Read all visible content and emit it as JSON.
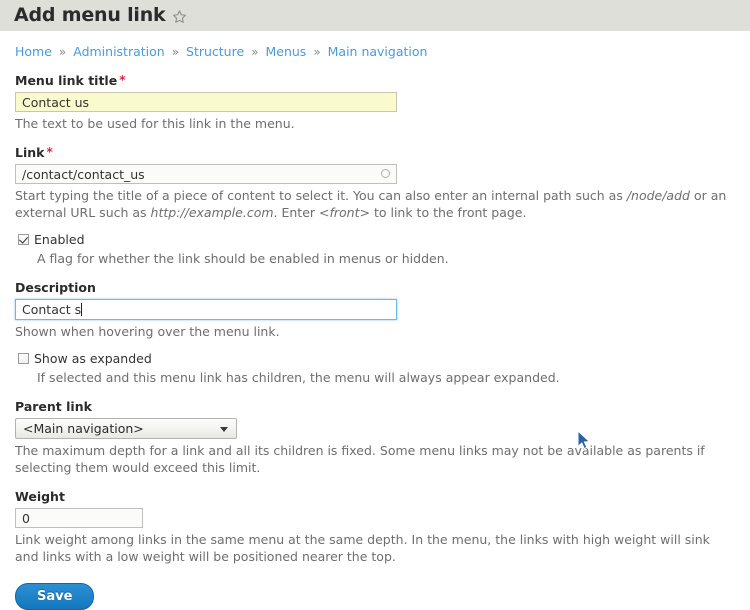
{
  "header": {
    "title": "Add menu link",
    "star_icon": "star-outline-icon"
  },
  "breadcrumb": {
    "separator": "»",
    "items": [
      {
        "label": "Home"
      },
      {
        "label": "Administration"
      },
      {
        "label": "Structure"
      },
      {
        "label": "Menus"
      },
      {
        "label": "Main navigation"
      }
    ]
  },
  "form": {
    "menu_link_title": {
      "label": "Menu link title",
      "required_mark": "*",
      "value": "Contact us",
      "description": "The text to be used for this link in the menu."
    },
    "link": {
      "label": "Link",
      "required_mark": "*",
      "value": "/contact/contact_us",
      "throbber_icon": "autocomplete-throbber-icon",
      "description_part1": "Start typing the title of a piece of content to select it. You can also enter an internal path such as ",
      "description_em1": "/node/add",
      "description_part2": " or an external URL such as ",
      "description_em2": "http://example.com",
      "description_part3": ". Enter <",
      "description_em3": "front",
      "description_part4": "> to link to the front page."
    },
    "enabled": {
      "label": "Enabled",
      "checked": true,
      "description": "A flag for whether the link should be enabled in menus or hidden."
    },
    "description_field": {
      "label": "Description",
      "value": "Contact s",
      "focused": true,
      "description": "Shown when hovering over the menu link."
    },
    "show_as_expanded": {
      "label": "Show as expanded",
      "checked": false,
      "description": "If selected and this menu link has children, the menu will always appear expanded."
    },
    "parent_link": {
      "label": "Parent link",
      "selected": "<Main navigation>",
      "chevron_icon": "chevron-down-icon",
      "description": "The maximum depth for a link and all its children is fixed. Some menu links may not be available as parents if selecting them would exceed this limit."
    },
    "weight": {
      "label": "Weight",
      "value": "0",
      "description": "Link weight among links in the same menu at the same depth. In the menu, the links with high weight will sink and links with a low weight will be positioned nearer the top."
    },
    "save_button": "Save"
  },
  "colors": {
    "header_bg": "#dfdfd9",
    "link_blue": "#4a9ade",
    "required_red": "#e02443",
    "autofill_yellow": "#fafbcd",
    "focus_blue": "#6bb8ec",
    "button_blue": "#1278bd"
  }
}
